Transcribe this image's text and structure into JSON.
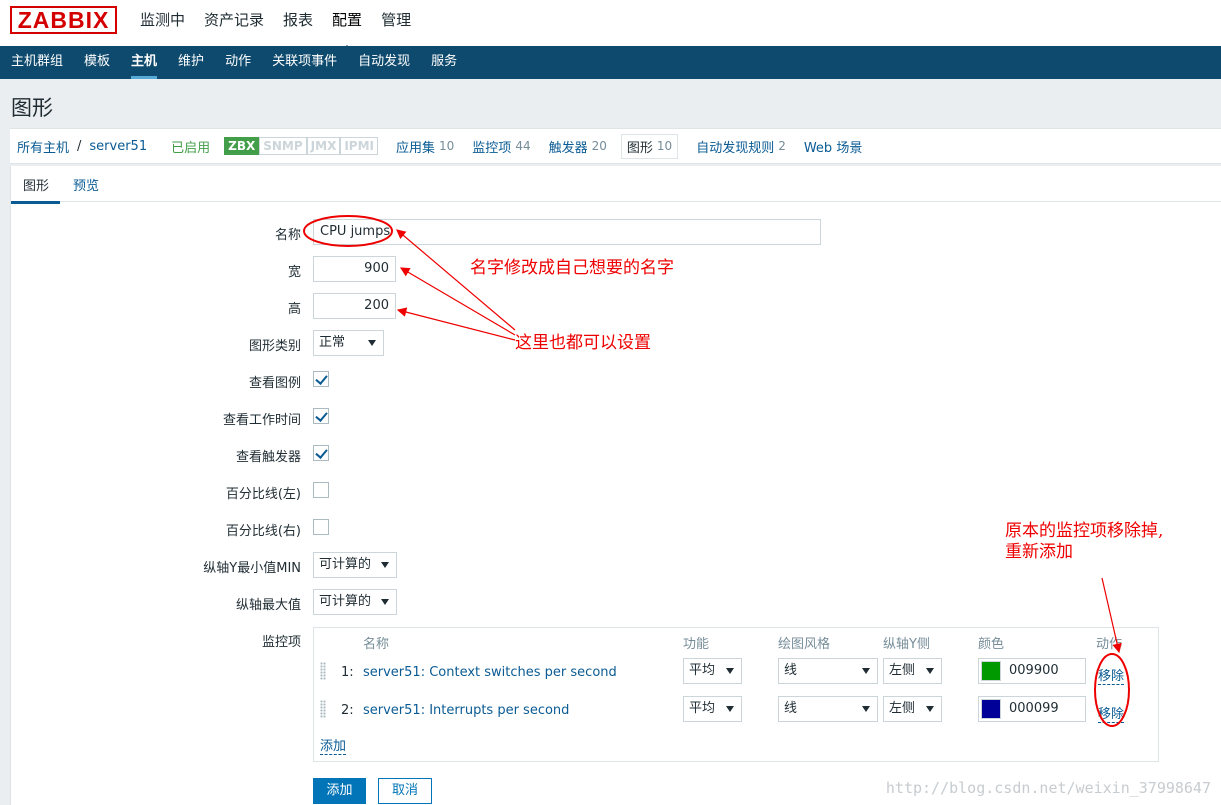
{
  "logo": "ZABBIX",
  "main_menu": [
    "监测中",
    "资产记录",
    "报表",
    "配置",
    "管理"
  ],
  "sub_menu": [
    "主机群组",
    "模板",
    "主机",
    "维护",
    "动作",
    "关联项事件",
    "自动发现",
    "服务"
  ],
  "page_title": "图形",
  "breadcrumb": {
    "all_hosts": "所有主机",
    "separator": "/",
    "host": "server51",
    "status": "已启用",
    "badges": [
      "ZBX",
      "SNMP",
      "JMX",
      "IPMI"
    ],
    "items": [
      {
        "label": "应用集",
        "count": "10"
      },
      {
        "label": "监控项",
        "count": "44"
      },
      {
        "label": "触发器",
        "count": "20"
      },
      {
        "label": "图形",
        "count": "10"
      },
      {
        "label": "自动发现规则",
        "count": "2"
      },
      {
        "label": "Web 场景",
        "count": ""
      }
    ]
  },
  "tabs": [
    "图形",
    "预览"
  ],
  "form": {
    "name_label": "名称",
    "name_value": "CPU jumps",
    "width_label": "宽",
    "width_value": "900",
    "height_label": "高",
    "height_value": "200",
    "type_label": "图形类别",
    "type_value": "正常",
    "show_legend_label": "查看图例",
    "show_worktime_label": "查看工作时间",
    "show_triggers_label": "查看触发器",
    "percentile_left_label": "百分比线(左)",
    "percentile_right_label": "百分比线(右)",
    "ymin_label": "纵轴Y最小值MIN",
    "ymin_value": "可计算的",
    "ymax_label": "纵轴最大值",
    "ymax_value": "可计算的",
    "items_label": "监控项"
  },
  "items_table": {
    "headers": [
      "名称",
      "功能",
      "绘图风格",
      "纵轴Y侧",
      "颜色",
      "动作"
    ],
    "rows": [
      {
        "num": "1:",
        "name": "server51: Context switches per second",
        "func": "平均",
        "style": "线",
        "side": "左侧",
        "color": "009900",
        "swatch": "#009900",
        "action": "移除"
      },
      {
        "num": "2:",
        "name": "server51: Interrupts per second",
        "func": "平均",
        "style": "线",
        "side": "左侧",
        "color": "000099",
        "swatch": "#000099",
        "action": "移除"
      }
    ],
    "add_link": "添加"
  },
  "buttons": {
    "add": "添加",
    "cancel": "取消"
  },
  "annotations": {
    "name_note": "名字修改成自己想要的名字",
    "size_note": "这里也都可以设置",
    "remove_note_1": "原本的监控项移除掉,",
    "remove_note_2": "重新添加"
  },
  "watermark": "http://blog.csdn.net/weixin_37998647"
}
